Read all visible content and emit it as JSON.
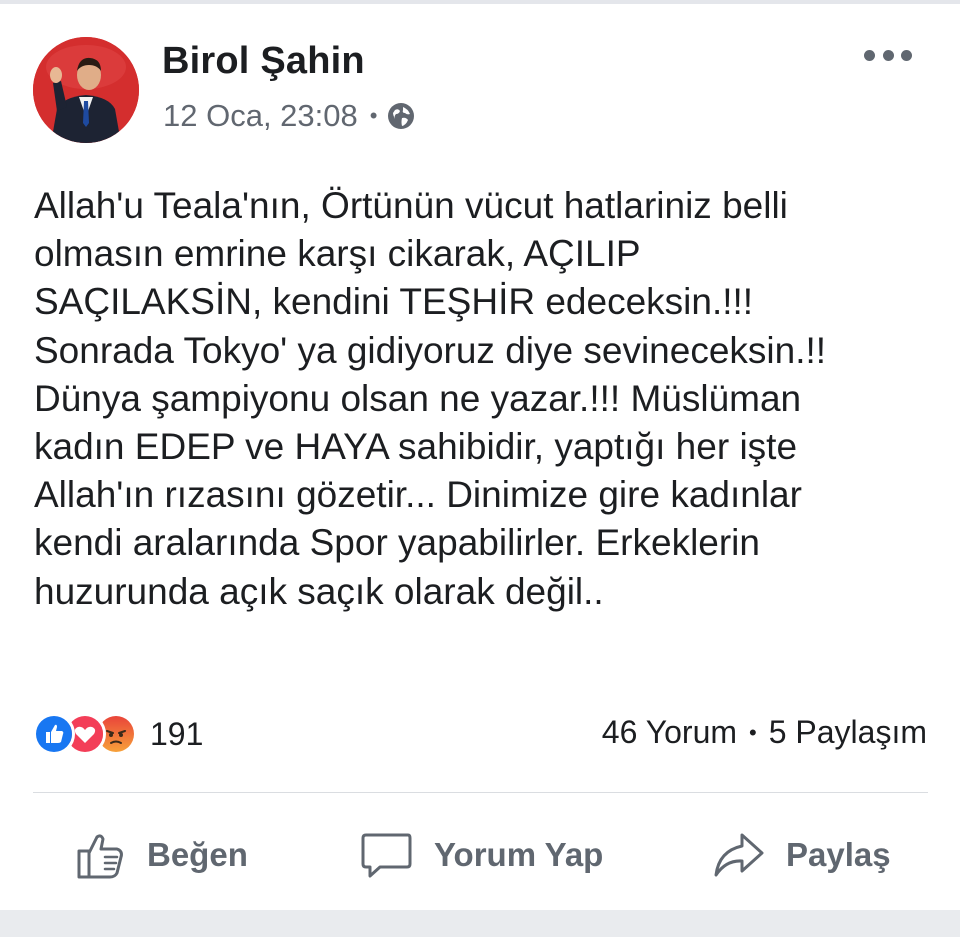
{
  "post": {
    "author": "Birol Şahin",
    "timestamp": "12 Oca, 23:08",
    "separator": "•",
    "privacy_icon": "globe-icon",
    "menu_icon": "more-options-icon",
    "lines": [
      "Allah'u Teala'nın, Örtünün vücut hatlariniz belli",
      "olmasın emrine karşı cikarak, AÇILIP",
      "SAÇILAKSİN, kendini TEŞHİR edeceksin.!!!",
      "Sonrada Tokyo' ya gidiyoruz diye sevineceksin.!!",
      "Dünya şampiyonu olsan ne yazar.!!!  Müslüman",
      "kadın EDEP ve HAYA sahibidir, yaptığı her işte",
      "Allah'ın rızasını gözetir...  Dinimize gire kadınlar",
      "kendi aralarında Spor yapabilirler. Erkeklerin",
      "huzurunda açık saçık olarak değil.."
    ]
  },
  "reactions": {
    "icons": [
      "like-reaction-icon",
      "love-reaction-icon",
      "angry-reaction-icon"
    ],
    "count": "191"
  },
  "stats": {
    "comments": "46 Yorum",
    "separator": "•",
    "shares": "5 Paylaşım"
  },
  "actions": {
    "like": "Beğen",
    "comment": "Yorum Yap",
    "share": "Paylaş"
  },
  "colors": {
    "like_blue": "#1877f2",
    "love_red": "#f33e58",
    "angry_orange": "#f7714c",
    "avatar_bg": "#d42e2e",
    "meta_gray": "#616770"
  }
}
